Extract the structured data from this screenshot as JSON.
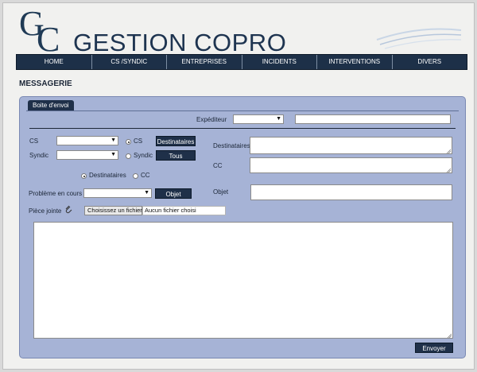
{
  "header": {
    "logo_g": "G",
    "logo_c": "C",
    "brand": "GESTION COPRO"
  },
  "nav": {
    "items": [
      {
        "label": "HOME"
      },
      {
        "label": "CS /SYNDIC"
      },
      {
        "label": "ENTREPRISES"
      },
      {
        "label": "INCIDENTS"
      },
      {
        "label": "INTERVENTIONS"
      },
      {
        "label": "DIVERS"
      }
    ]
  },
  "page": {
    "title": "MESSAGERIE"
  },
  "form": {
    "tab_label": "Boite d'envoi",
    "expediteur_label": "Expéditeur",
    "expediteur_select": "",
    "expediteur_text": "",
    "cs_label": "CS",
    "cs_select": "",
    "syndic_label": "Syndic",
    "syndic_select": "",
    "radio_cs_label": "CS",
    "radio_syndic_label": "Syndic",
    "destinataires_button": "Destinataires",
    "tous_button": "Tous",
    "destinataires_label": "Destinataires",
    "cc_label": "CC",
    "objet_label": "Objet",
    "radio_destinataires_label": "Destinataires",
    "radio_cc_label": "CC",
    "probleme_label": "Problème en cours",
    "probleme_select": "",
    "objet_button": "Objet",
    "piece_jointe_label": "Pièce jointe",
    "file_button": "Choisissez un fichier",
    "file_name": "Aucun fichier choisi",
    "message_body": "",
    "envoyer_button": "Envoyer"
  },
  "colors": {
    "nav_bg": "#1d3048",
    "panel_bg": "#a6b3d6",
    "button_bg": "#1f3049",
    "brand_color": "#1e3450"
  }
}
